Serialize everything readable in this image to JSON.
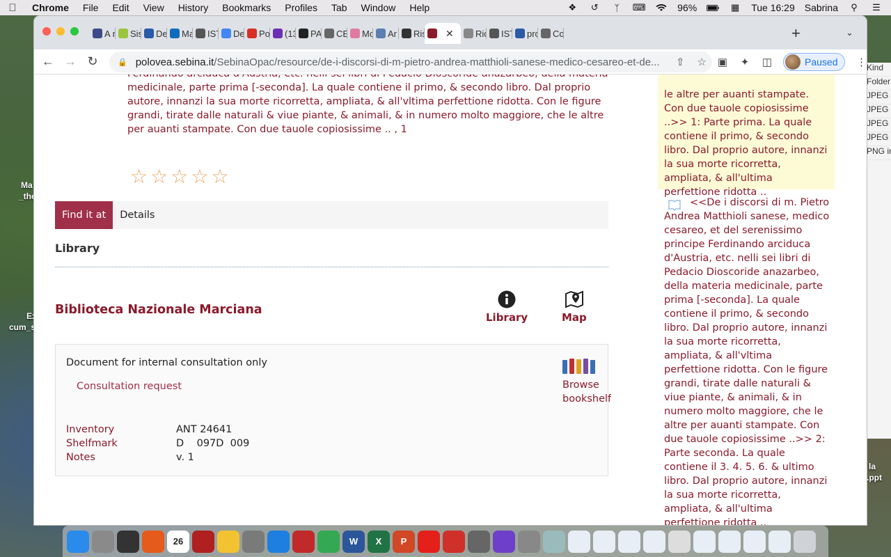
{
  "menubar": {
    "items": [
      "Chrome",
      "File",
      "Edit",
      "View",
      "History",
      "Bookmarks",
      "Profiles",
      "Tab",
      "Window",
      "Help"
    ],
    "battery": "96%",
    "clock": "Tue 16:29",
    "user": "Sabrina"
  },
  "desktop": {
    "labels": [
      "Ma",
      "_the",
      "Ex",
      "cum_s",
      "la",
      ".ppt"
    ],
    "finder_column": [
      "Kind",
      "Folder",
      "JPEG i",
      "JPEG i",
      "JPEG i",
      "JPEG i",
      "PNG in"
    ]
  },
  "browser": {
    "tabs": [
      {
        "label": "A r",
        "color": "#3c4a8a"
      },
      {
        "label": "Sis",
        "color": "#9bc53d"
      },
      {
        "label": "De",
        "color": "#2a5aa8"
      },
      {
        "label": "Ma",
        "color": "#0f6cbd"
      },
      {
        "label": "IST",
        "color": "#555"
      },
      {
        "label": "De",
        "color": "#4285f4"
      },
      {
        "label": "Po",
        "color": "#d93025"
      },
      {
        "label": "(13",
        "color": "#6b2fb3"
      },
      {
        "label": "PA",
        "color": "#222"
      },
      {
        "label": "CE",
        "color": "#666"
      },
      {
        "label": "Mc",
        "color": "#e07ba0"
      },
      {
        "label": "Ar",
        "color": "#5a7fb0"
      },
      {
        "label": "Ris",
        "color": "#333"
      },
      {
        "label": "",
        "color": "#8b1a2b",
        "active": true
      },
      {
        "label": "Ric",
        "color": "#888"
      },
      {
        "label": "IST",
        "color": "#555"
      },
      {
        "label": "prc",
        "color": "#2a5aa8"
      },
      {
        "label": "Co",
        "color": "#666"
      }
    ],
    "url_host": "polovea.sebina.it",
    "url_path": "/SebinaOpac/resource/de-i-discorsi-di-m-pietro-andrea-matthioli-sanese-medico-cesareo-et-de...",
    "profile_status": "Paused"
  },
  "record": {
    "description": "Ferdinando arciduca d'Austria, etc. nelli sei libri di Pedacio Dioscoride anazarbeo, della materia medicinale, parte prima [-seconda]. La quale contiene il primo, & secondo libro. Dal proprio autore, innanzi la sua morte ricorretta, ampliata, & all'vltima perfettione ridotta. Con le figure grandi, tirate dalle naturali & viue piante, & animali, & in numero molto maggiore, che le altre per auanti stampate. Con due tauole copiosissime .. , 1",
    "rating": {
      "value": 0,
      "max": 5,
      "star_glyph": "☆"
    },
    "tabs": [
      "Find it at",
      "Details"
    ],
    "section_title": "Library",
    "library_name": "Biblioteca Nazionale Marciana",
    "actions": {
      "library": "Library",
      "map": "Map"
    },
    "holding": {
      "note": "Document for internal consultation only",
      "request_link": "Consultation request",
      "browse": "Browse bookshelf",
      "fields": [
        {
          "key": "Inventory",
          "value": "ANT 24641"
        },
        {
          "key": "Shelfmark",
          "value": "D    097D  009"
        },
        {
          "key": "Notes",
          "value": "v. 1"
        }
      ]
    }
  },
  "sidebar": {
    "highlight_text": "le altre per auanti stampate. Con due tauole copiosissime ..>> 1: Parte prima. La quale contiene il primo, & secondo libro. Dal proprio autore, innanzi la sua morte ricorretta, ampliata, & all'ultima perfettione ridotta ..",
    "second_text": "<<De i discorsi di m. Pietro Andrea Matthioli sanese, medico cesareo, et del serenissimo principe Ferdinando arciduca d'Austria, etc. nelli sei libri di Pedacio Dioscoride anazarbeo, della materia medicinale, parte prima [-seconda]. La quale contiene il primo, & secondo libro. Dal proprio autore, innanzi la sua morte ricorretta, ampliata, & all'vltima perfettione ridotta. Con le figure grandi, tirate dalle naturali & viue piante, & animali, & in numero molto maggiore, che le altre per auanti stampate. Con due tauole copiosissime ..>> 2: Parte seconda. La quale contiene il 3. 4. 5. 6. & ultimo libro. Dal proprio autore, innanzi la sua morte ricorretta, ampliata, & all'ultima perfettione ridotta .."
  },
  "dock": {
    "apps": [
      {
        "name": "finder",
        "color": "#2a8bea"
      },
      {
        "name": "launchpad",
        "color": "#8a8a8a"
      },
      {
        "name": "mission-control",
        "color": "#333"
      },
      {
        "name": "firefox",
        "color": "#e55b1b"
      },
      {
        "name": "calendar",
        "color": "#ffffff",
        "label": "26"
      },
      {
        "name": "photo-booth",
        "color": "#b02020"
      },
      {
        "name": "photos",
        "color": "#f2c230"
      },
      {
        "name": "system-preferences",
        "color": "#7a7a7a"
      },
      {
        "name": "safari",
        "color": "#1e7fe0"
      },
      {
        "name": "network-app",
        "color": "#c02a2a"
      },
      {
        "name": "chrome",
        "color": "#34a853"
      },
      {
        "name": "word",
        "color": "#2b579a",
        "label": "W"
      },
      {
        "name": "excel",
        "color": "#217346",
        "label": "X"
      },
      {
        "name": "powerpoint",
        "color": "#d24726",
        "label": "P"
      },
      {
        "name": "acrobat",
        "color": "#e4201a"
      },
      {
        "name": "xmind",
        "color": "#d0302a"
      },
      {
        "name": "calculator",
        "color": "#666"
      },
      {
        "name": "github",
        "color": "#6e40c9"
      },
      {
        "name": "utilities",
        "color": "#888"
      },
      {
        "name": "preview",
        "color": "#9bb"
      },
      {
        "name": "doc-1",
        "color": "#e8eef5"
      },
      {
        "name": "doc-2",
        "color": "#e8eef5"
      },
      {
        "name": "doc-3",
        "color": "#e8eef5"
      },
      {
        "name": "doc-4",
        "color": "#e8eef5"
      },
      {
        "name": "doc-5",
        "color": "#ddd"
      },
      {
        "name": "doc-6",
        "color": "#e8eef5"
      },
      {
        "name": "doc-7",
        "color": "#e8eef5"
      },
      {
        "name": "doc-8",
        "color": "#e8eef5"
      },
      {
        "name": "doc-9",
        "color": "#e8eef5"
      },
      {
        "name": "trash",
        "color": "#cfd3d8"
      }
    ]
  },
  "colors": {
    "accent": "#8b1a2b",
    "tab_active": "#a0304a",
    "highlight": "#fdfbd6"
  }
}
